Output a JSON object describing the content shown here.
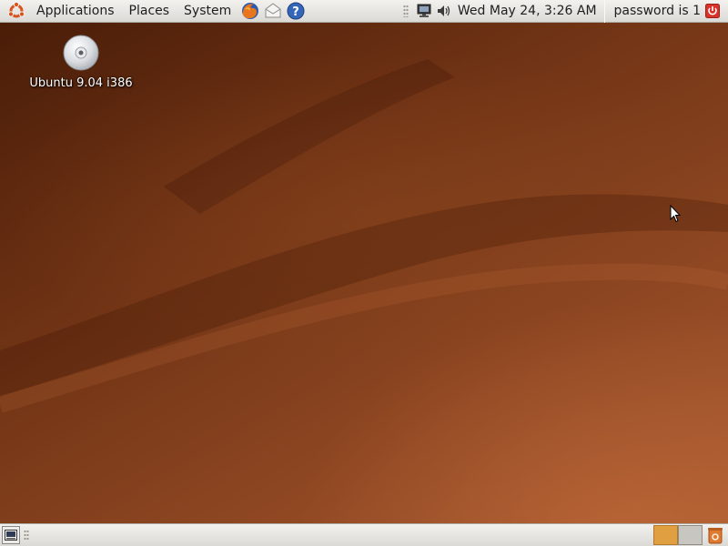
{
  "top_panel": {
    "menus": [
      "Applications",
      "Places",
      "System"
    ],
    "launchers": [
      "firefox-icon",
      "mail-icon",
      "help-icon"
    ],
    "clock": "Wed May 24,  3:26 AM",
    "user_label": "password is 1"
  },
  "desktop": {
    "icon_label": "Ubuntu 9.04 i386",
    "icon": "cdrom-icon"
  },
  "bottom_panel": {
    "workspaces": [
      "active",
      "inactive"
    ],
    "trash": "trash-icon"
  },
  "colors": {
    "panel": "#dcdad5",
    "wallpaper_dark": "#4a1d08",
    "wallpaper_light": "#a85a30",
    "workspace_active": "#e0a042"
  }
}
